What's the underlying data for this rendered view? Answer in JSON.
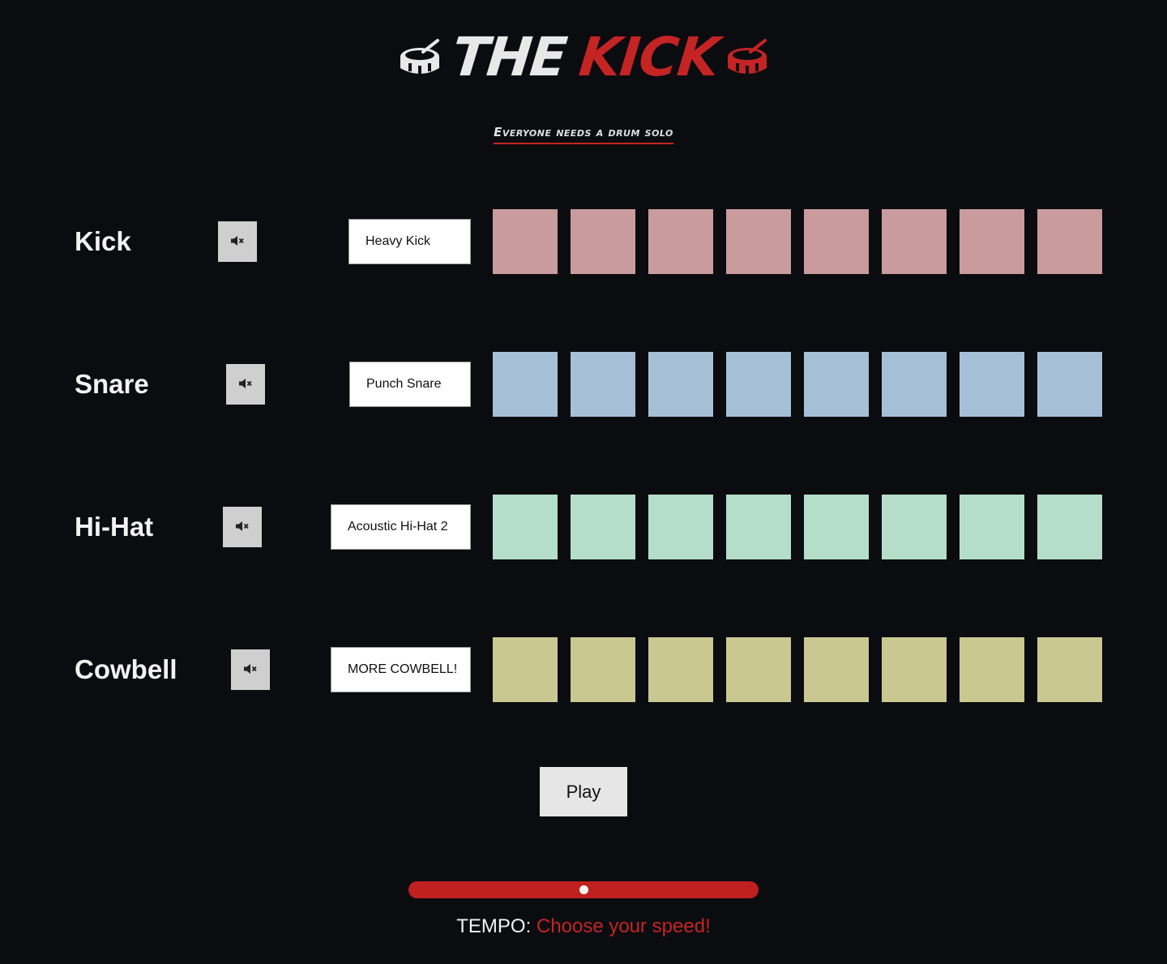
{
  "header": {
    "title_the": "THE",
    "title_kick": "KICK",
    "subtitle": "Everyone needs a drum solo",
    "left_icon": "drum-icon",
    "right_icon": "drum-icon"
  },
  "tracks": [
    {
      "name": "Kick",
      "sound": "Heavy Kick",
      "color": "#c99b9c",
      "mute_icon": "speaker-mute-icon",
      "pads": 8
    },
    {
      "name": "Snare",
      "sound": "Punch Snare",
      "color": "#a5bfd6",
      "mute_icon": "speaker-mute-icon",
      "pads": 8
    },
    {
      "name": "Hi-Hat",
      "sound": "Acoustic Hi-Hat 2",
      "color": "#b4dec9",
      "mute_icon": "speaker-mute-icon",
      "pads": 8
    },
    {
      "name": "Cowbell",
      "sound": "MORE COWBELL!",
      "color": "#c8c890",
      "mute_icon": "speaker-mute-icon",
      "pads": 8
    }
  ],
  "controls": {
    "play_label": "Play",
    "tempo_label": "TEMPO:",
    "tempo_hint": "Choose your speed!",
    "tempo_value_fraction": 0.5
  },
  "colors": {
    "background": "#0b0c10",
    "accent": "#c42424"
  }
}
